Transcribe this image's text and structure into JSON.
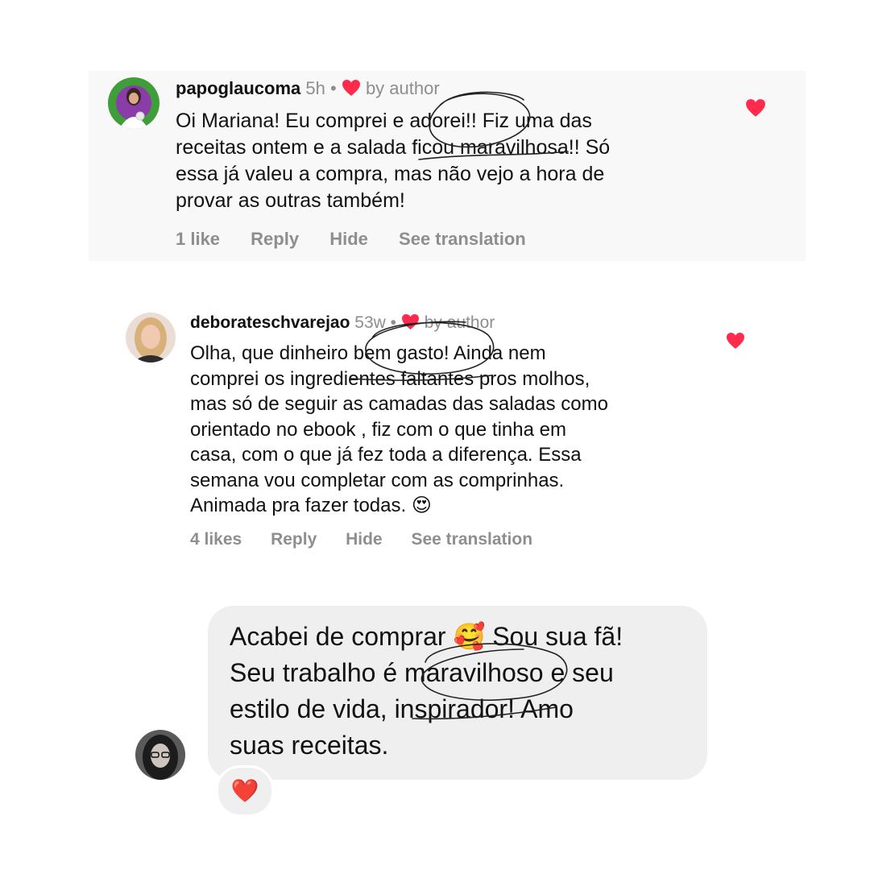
{
  "comments": [
    {
      "username": "papoglaucoma",
      "time": "5h",
      "dot": "•",
      "by_author": "by author",
      "lines": [
        "Oi Mariana! Eu comprei e adorei!! Fiz uma das",
        "receitas ontem e a salada ficou maravilhosa!! Só",
        "essa já valeu a compra, mas não vejo a hora de",
        "provar as outras também!"
      ],
      "likes": "1 like",
      "reply": "Reply",
      "hide": "Hide",
      "translate": "See translation"
    },
    {
      "username": "deborateschvarejao",
      "time": "53w",
      "dot": "•",
      "by_author": "by author",
      "lines": [
        "Olha, que dinheiro bem gasto! Ainda nem",
        "comprei os ingredientes faltantes pros molhos,",
        "mas só de seguir as camadas das saladas como",
        "orientado no ebook , fiz com o que tinha em",
        "casa, com o que já fez toda a diferença. Essa",
        "semana vou completar com as comprinhas.",
        "Animada pra fazer todas. 😍"
      ],
      "likes": "4 likes",
      "reply": "Reply",
      "hide": "Hide",
      "translate": "See translation"
    }
  ],
  "message": {
    "lines": [
      "Acabei de comprar 🥰 Sou sua fã!",
      "Seu trabalho é maravilhoso e seu",
      "estilo de vida, inspirador! Amo",
      "suas receitas."
    ],
    "reaction": "❤️"
  },
  "colors": {
    "heart": "#ff2a4d",
    "meta": "#8e8e8e",
    "bubble": "#efefef"
  },
  "icons": {
    "inline_heart": "heart-icon",
    "like_heart": "like-heart-icon"
  }
}
